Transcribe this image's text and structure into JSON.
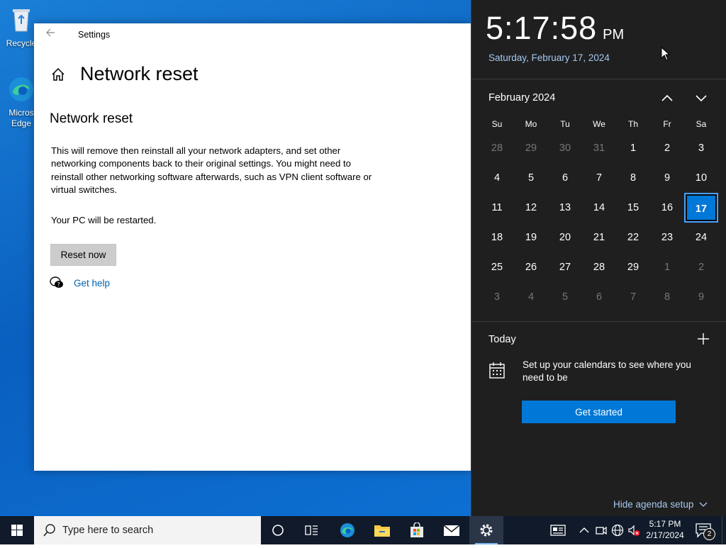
{
  "desktop": {
    "icons": [
      {
        "label": "Recycle"
      },
      {
        "label": "Micros\nEdge"
      }
    ]
  },
  "settings": {
    "window_title": "Settings",
    "page_title": "Network reset",
    "section_title": "Network reset",
    "description": "This will remove then reinstall all your network adapters, and set other networking components back to their original settings. You might need to reinstall other networking software afterwards, such as VPN client software or virtual switches.",
    "restart_note": "Your PC will be restarted.",
    "reset_button": "Reset now",
    "help_link": "Get help"
  },
  "flyout": {
    "time": "5:17:58",
    "ampm": "PM",
    "date": "Saturday, February 17, 2024",
    "month_label": "February 2024",
    "weekdays": [
      "Su",
      "Mo",
      "Tu",
      "We",
      "Th",
      "Fr",
      "Sa"
    ],
    "weeks": [
      [
        "28",
        "29",
        "30",
        "31",
        "1",
        "2",
        "3"
      ],
      [
        "4",
        "5",
        "6",
        "7",
        "8",
        "9",
        "10"
      ],
      [
        "11",
        "12",
        "13",
        "14",
        "15",
        "16",
        "17"
      ],
      [
        "18",
        "19",
        "20",
        "21",
        "22",
        "23",
        "24"
      ],
      [
        "25",
        "26",
        "27",
        "28",
        "29",
        "1",
        "2"
      ],
      [
        "3",
        "4",
        "5",
        "6",
        "7",
        "8",
        "9"
      ]
    ],
    "today_label": "Today",
    "agenda_text": "Set up your calendars to see where you need to be",
    "get_started": "Get started",
    "hide_agenda": "Hide agenda setup"
  },
  "taskbar": {
    "search_placeholder": "Type here to search",
    "time": "5:17 PM",
    "date": "2/17/2024",
    "notification_count": "2"
  },
  "colors": {
    "accent": "#0078d7",
    "link": "#0063b1",
    "flyout_bg": "#1f1f1f",
    "taskbar_bg": "#101a2a"
  }
}
